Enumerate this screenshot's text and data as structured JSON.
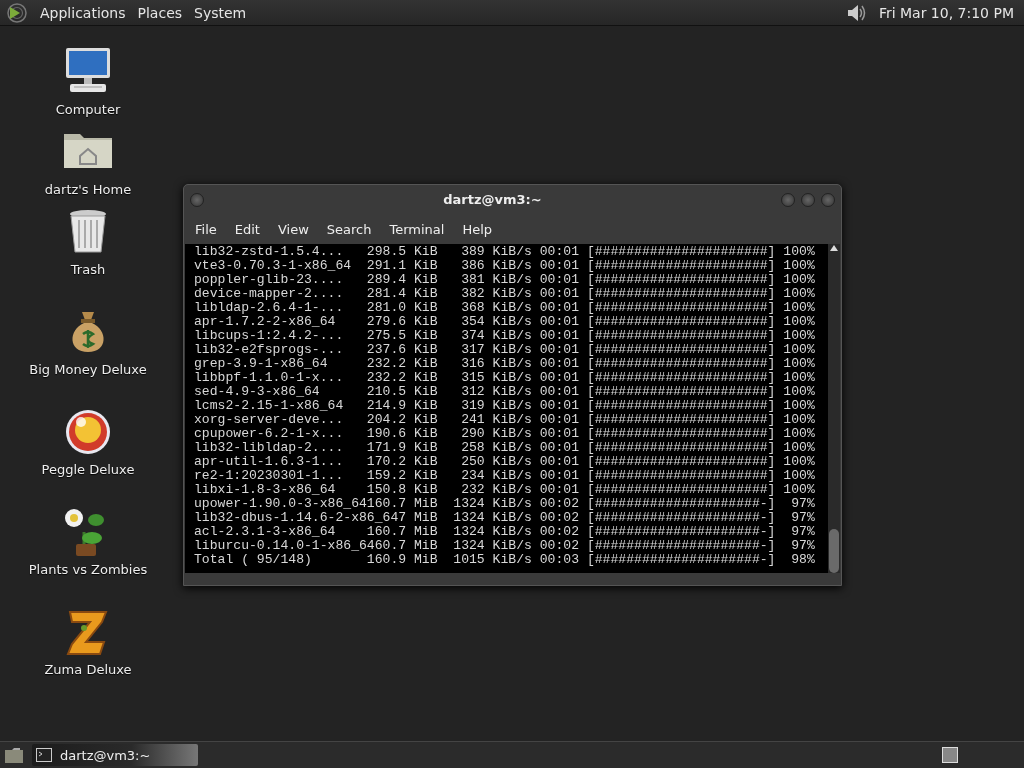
{
  "top_panel": {
    "menus": [
      "Applications",
      "Places",
      "System"
    ],
    "clock": "Fri Mar 10,  7:10 PM"
  },
  "desktop_icons": [
    {
      "label": "Computer",
      "kind": "computer"
    },
    {
      "label": "dartz's Home",
      "kind": "folder"
    },
    {
      "label": "Trash",
      "kind": "trash"
    },
    {
      "label": "Big Money Deluxe",
      "kind": "moneybag"
    },
    {
      "label": "Peggle Deluxe",
      "kind": "ball"
    },
    {
      "label": "Plants vs Zombies",
      "kind": "plant"
    },
    {
      "label": "Zuma Deluxe",
      "kind": "idol"
    }
  ],
  "terminal": {
    "title": "dartz@vm3:~",
    "menu": [
      "File",
      "Edit",
      "View",
      "Search",
      "Terminal",
      "Help"
    ],
    "lines": [
      "lib32-zstd-1.5.4...   298.5 KiB   389 KiB/s 00:01 [######################] 100%",
      "vte3-0.70.3-1-x86_64  291.1 KiB   386 KiB/s 00:01 [######################] 100%",
      "poppler-glib-23....   289.4 KiB   381 KiB/s 00:01 [######################] 100%",
      "device-mapper-2....   281.4 KiB   382 KiB/s 00:01 [######################] 100%",
      "libldap-2.6.4-1-...   281.0 KiB   368 KiB/s 00:01 [######################] 100%",
      "apr-1.7.2-2-x86_64    279.6 KiB   354 KiB/s 00:01 [######################] 100%",
      "libcups-1:2.4.2-...   275.5 KiB   374 KiB/s 00:01 [######################] 100%",
      "lib32-e2fsprogs-...   237.6 KiB   317 KiB/s 00:01 [######################] 100%",
      "grep-3.9-1-x86_64     232.2 KiB   316 KiB/s 00:01 [######################] 100%",
      "libbpf-1.1.0-1-x...   232.2 KiB   315 KiB/s 00:01 [######################] 100%",
      "sed-4.9-3-x86_64      210.5 KiB   312 KiB/s 00:01 [######################] 100%",
      "lcms2-2.15-1-x86_64   214.9 KiB   319 KiB/s 00:01 [######################] 100%",
      "xorg-server-deve...   204.2 KiB   241 KiB/s 00:01 [######################] 100%",
      "cpupower-6.2-1-x...   190.6 KiB   290 KiB/s 00:01 [######################] 100%",
      "lib32-libldap-2....   171.9 KiB   258 KiB/s 00:01 [######################] 100%",
      "apr-util-1.6.3-1...   170.2 KiB   250 KiB/s 00:01 [######################] 100%",
      "re2-1:20230301-1...   159.2 KiB   234 KiB/s 00:01 [######################] 100%",
      "libxi-1.8-3-x86_64    150.8 KiB   232 KiB/s 00:01 [######################] 100%",
      "upower-1.90.0-3-x86_64160.7 MiB  1324 KiB/s 00:02 [#####################-]  97%",
      "lib32-dbus-1.14.6-2-x86_647 MiB  1324 KiB/s 00:02 [#####################-]  97%",
      "acl-2.3.1-3-x86_64    160.7 MiB  1324 KiB/s 00:02 [#####################-]  97%",
      "liburcu-0.14.0-1-x86_6460.7 MiB  1324 KiB/s 00:02 [#####################-]  97%",
      "Total ( 95/148)       160.9 MiB  1015 KiB/s 00:03 [#####################-]  98%"
    ]
  },
  "taskbar": {
    "tasks": [
      {
        "label": "dartz@vm3:~",
        "selected": true
      }
    ]
  }
}
